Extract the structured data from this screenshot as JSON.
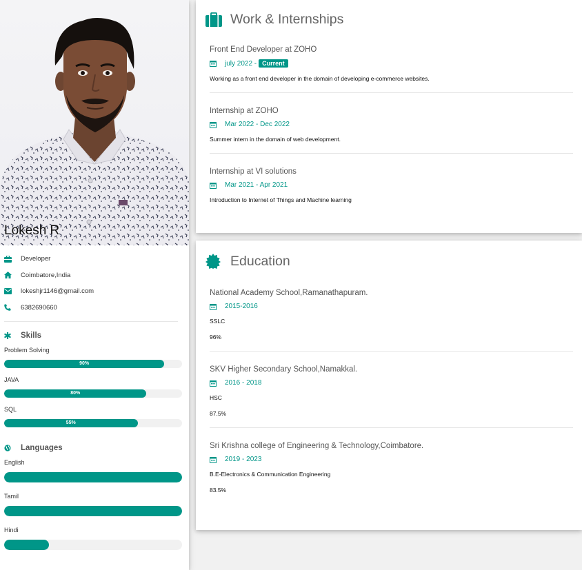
{
  "profile": {
    "name": "Lokesh R",
    "info": [
      {
        "icon": "briefcase-icon",
        "text": "Developer"
      },
      {
        "icon": "home-icon",
        "text": "Coimbatore,India"
      },
      {
        "icon": "envelope-icon",
        "text": "lokeshjr1146@gmail.com"
      },
      {
        "icon": "phone-icon",
        "text": "6382690660"
      }
    ]
  },
  "skills": {
    "title": "Skills",
    "icon": "asterisk-icon",
    "items": [
      {
        "name": "Problem Solving",
        "percent_label": "90%",
        "level": 0.9
      },
      {
        "name": "JAVA",
        "percent_label": "80%",
        "level": 0.8
      },
      {
        "name": "SQL",
        "percent_label": "55%",
        "level": 0.75
      }
    ]
  },
  "languages": {
    "title": "Languages",
    "icon": "globe-icon",
    "items": [
      {
        "name": "English",
        "level": 1.0
      },
      {
        "name": "Tamil",
        "level": 1.0
      },
      {
        "name": "Hindi",
        "level": 0.25
      }
    ]
  },
  "work": {
    "title": "Work & Internships",
    "icon": "suitcase-icon",
    "entries": [
      {
        "title": "Front End Developer at ZOHO",
        "date": "july 2022 -",
        "tag": "Current",
        "desc": "Working as a front end developer in the domain of developing e-commerce websites."
      },
      {
        "title": "Internship at ZOHO",
        "date": "Mar 2022 - Dec 2022",
        "tag": "",
        "desc": "Summer intern in the domain of web development."
      },
      {
        "title": "Internship at VI solutions",
        "date": "Mar 2021 - Apr 2021",
        "tag": "",
        "desc": "Introduction to Internet of Things and Machine learning"
      }
    ]
  },
  "education": {
    "title": "Education",
    "icon": "certificate-icon",
    "entries": [
      {
        "title": "National Academy School,Ramanathapuram.",
        "date": "2015-2016",
        "degree": "SSLC",
        "score": "96%"
      },
      {
        "title": "SKV Higher Secondary School,Namakkal.",
        "date": "2016 - 2018",
        "degree": "HSC",
        "score": "87.5%"
      },
      {
        "title": "Sri Krishna college of Engineering & Technology,Coimbatore.",
        "date": "2019 - 2023",
        "degree": "B.E-Electronics & Communication Engineering",
        "score": "83.5%"
      }
    ]
  },
  "colors": {
    "accent": "#009688",
    "background": "#f1f1f1",
    "card": "#ffffff"
  }
}
